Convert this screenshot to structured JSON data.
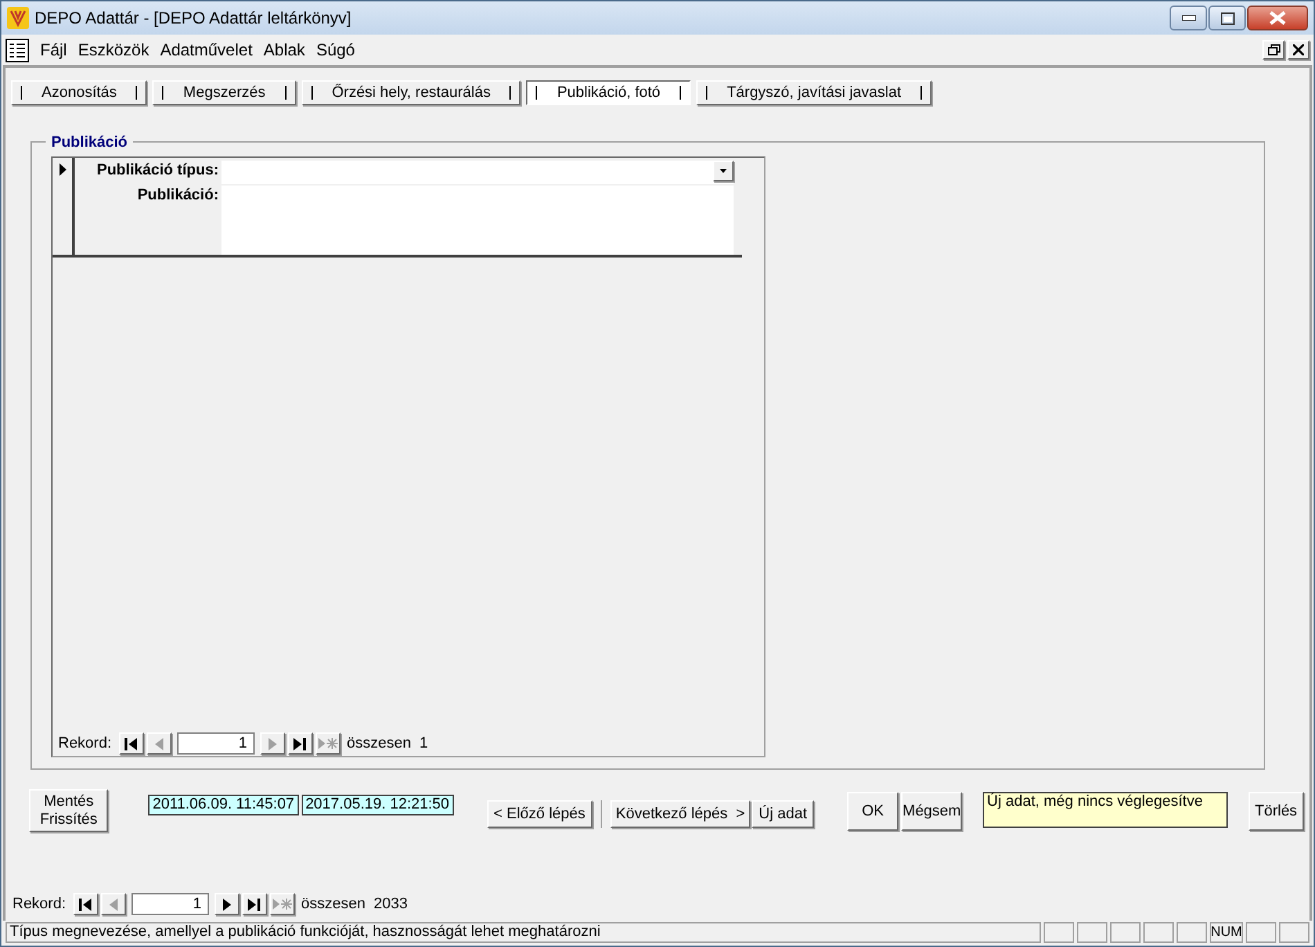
{
  "window": {
    "title": "DEPO Adattár - [DEPO Adattár leltárkönyv]"
  },
  "menu": [
    "Fájl",
    "Eszközök",
    "Adatművelet",
    "Ablak",
    "Súgó"
  ],
  "tabs": [
    {
      "label": "Azonosítás",
      "selected": false
    },
    {
      "label": "Megszerzés",
      "selected": false
    },
    {
      "label": "Őrzési hely, restaurálás",
      "selected": false
    },
    {
      "label": "Publikáció, fotó",
      "selected": true
    },
    {
      "label": "Tárgyszó, javítási javaslat",
      "selected": false
    }
  ],
  "group": {
    "title": "Publikáció",
    "fields": [
      {
        "label": "Publikáció típus:",
        "kind": "combo"
      },
      {
        "label": "Publikáció:",
        "kind": "memo"
      }
    ],
    "navigator": {
      "label": "Rekord:",
      "value": "1",
      "total_label": "összesen",
      "total": "1",
      "buttons": [
        {
          "kind": "first",
          "disabled": false
        },
        {
          "kind": "prev",
          "disabled": true
        },
        {
          "kind": "next",
          "disabled": true
        },
        {
          "kind": "last",
          "disabled": false
        },
        {
          "kind": "new",
          "disabled": true
        }
      ]
    }
  },
  "save_button": [
    "Mentés",
    "Frissítés"
  ],
  "timestamps": [
    "2011.06.09. 11:45:07",
    "2017.05.19. 12:21:50"
  ],
  "step_buttons": [
    "< Előző lépés",
    "Következő lépés  >",
    "Új adat"
  ],
  "ok_buttons": [
    "OK",
    "Mégsem"
  ],
  "status_note": "Új adat, még nincs véglegesítve",
  "delete_button": "Törlés",
  "navigator": {
    "label": "Rekord:",
    "value": "1",
    "total_label": "összesen",
    "total": "2033",
    "buttons": [
      {
        "kind": "first",
        "disabled": false
      },
      {
        "kind": "prev",
        "disabled": true
      },
      {
        "kind": "next",
        "disabled": false
      },
      {
        "kind": "last",
        "disabled": false
      },
      {
        "kind": "new",
        "disabled": true
      }
    ]
  },
  "status_bar": {
    "message": "Típus megnevezése, amellyel a publikáció funkcióját, hasznosságát lehet meghatározni",
    "num_indicator": "NUM"
  }
}
